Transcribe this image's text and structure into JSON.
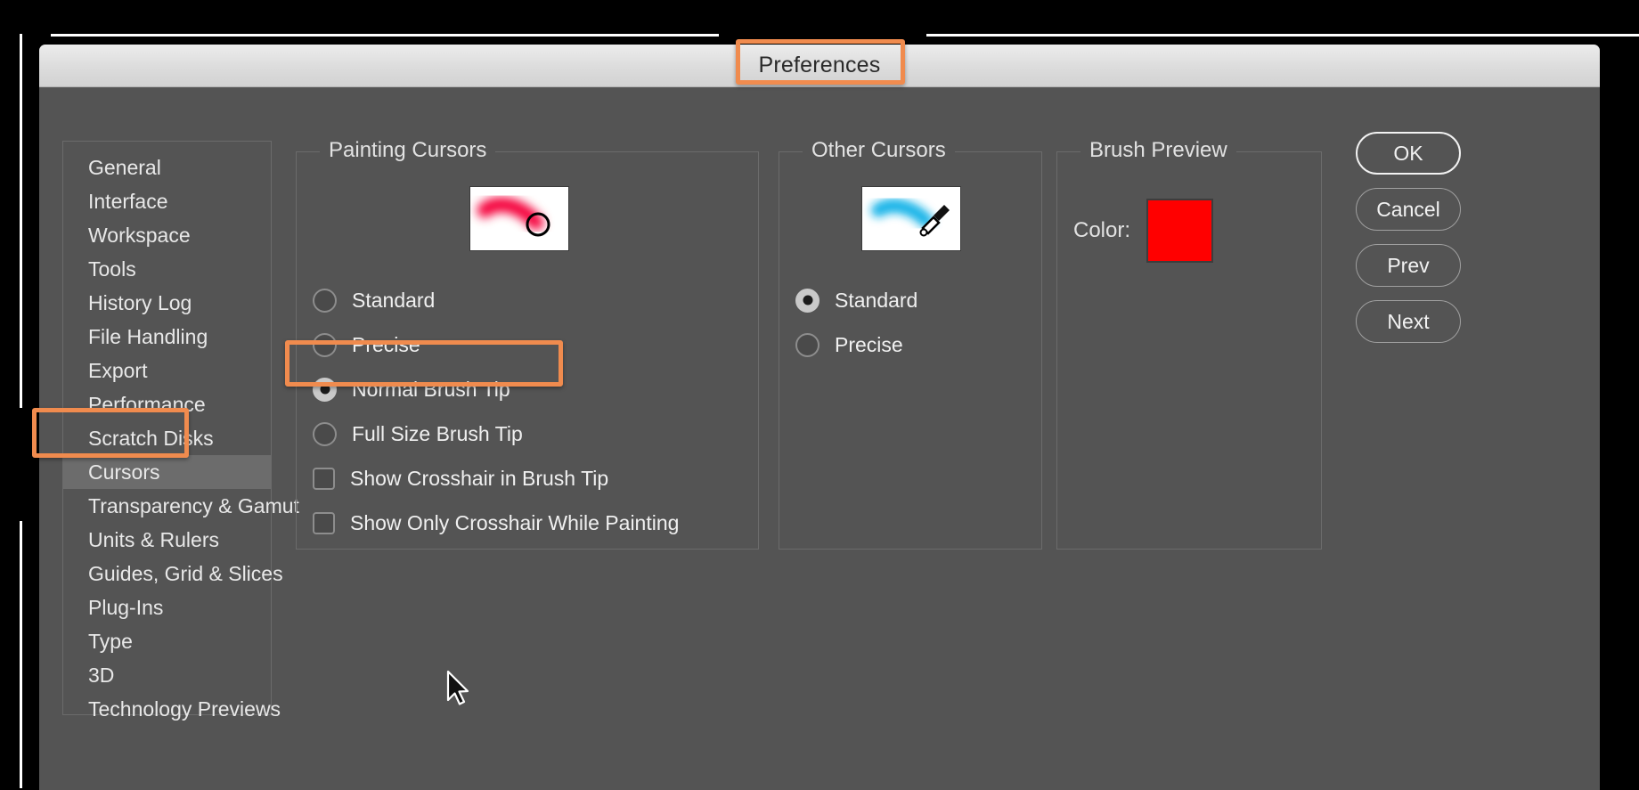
{
  "window": {
    "title": "Preferences"
  },
  "sidebar": {
    "items": [
      {
        "label": "General",
        "selected": false
      },
      {
        "label": "Interface",
        "selected": false
      },
      {
        "label": "Workspace",
        "selected": false
      },
      {
        "label": "Tools",
        "selected": false
      },
      {
        "label": "History Log",
        "selected": false
      },
      {
        "label": "File Handling",
        "selected": false
      },
      {
        "label": "Export",
        "selected": false
      },
      {
        "label": "Performance",
        "selected": false
      },
      {
        "label": "Scratch Disks",
        "selected": false
      },
      {
        "label": "Cursors",
        "selected": true
      },
      {
        "label": "Transparency & Gamut",
        "selected": false
      },
      {
        "label": "Units & Rulers",
        "selected": false
      },
      {
        "label": "Guides, Grid & Slices",
        "selected": false
      },
      {
        "label": "Plug-Ins",
        "selected": false
      },
      {
        "label": "Type",
        "selected": false
      },
      {
        "label": "3D",
        "selected": false
      },
      {
        "label": "Technology Previews",
        "selected": false
      }
    ]
  },
  "painting_cursors": {
    "title": "Painting Cursors",
    "preview_icon": "red-brush-stroke-with-circle-cursor-preview",
    "preview_stroke_color": "#f5003a",
    "options": [
      {
        "label": "Standard",
        "type": "radio",
        "checked": false
      },
      {
        "label": "Precise",
        "type": "radio",
        "checked": false
      },
      {
        "label": "Normal Brush Tip",
        "type": "radio",
        "checked": true
      },
      {
        "label": "Full Size Brush Tip",
        "type": "radio",
        "checked": false
      },
      {
        "label": "Show Crosshair in Brush Tip",
        "type": "checkbox",
        "checked": false
      },
      {
        "label": "Show Only Crosshair While Painting",
        "type": "checkbox",
        "checked": false
      }
    ]
  },
  "other_cursors": {
    "title": "Other Cursors",
    "preview_icon": "cyan-brush-stroke-with-eyedropper-cursor-preview",
    "preview_stroke_color": "#17b4e8",
    "options": [
      {
        "label": "Standard",
        "type": "radio",
        "checked": true
      },
      {
        "label": "Precise",
        "type": "radio",
        "checked": false
      }
    ]
  },
  "brush_preview": {
    "title": "Brush Preview",
    "color_label": "Color:",
    "color_value": "#ff0000"
  },
  "buttons": [
    {
      "label": "OK",
      "primary": true
    },
    {
      "label": "Cancel",
      "primary": false
    },
    {
      "label": "Prev",
      "primary": false
    },
    {
      "label": "Next",
      "primary": false
    }
  ],
  "annotations": {
    "color": "#f08b4e",
    "targets": [
      "Preferences",
      "Cursors",
      "Normal Brush Tip"
    ]
  },
  "pointer": {
    "icon": "mouse-arrow-cursor"
  }
}
